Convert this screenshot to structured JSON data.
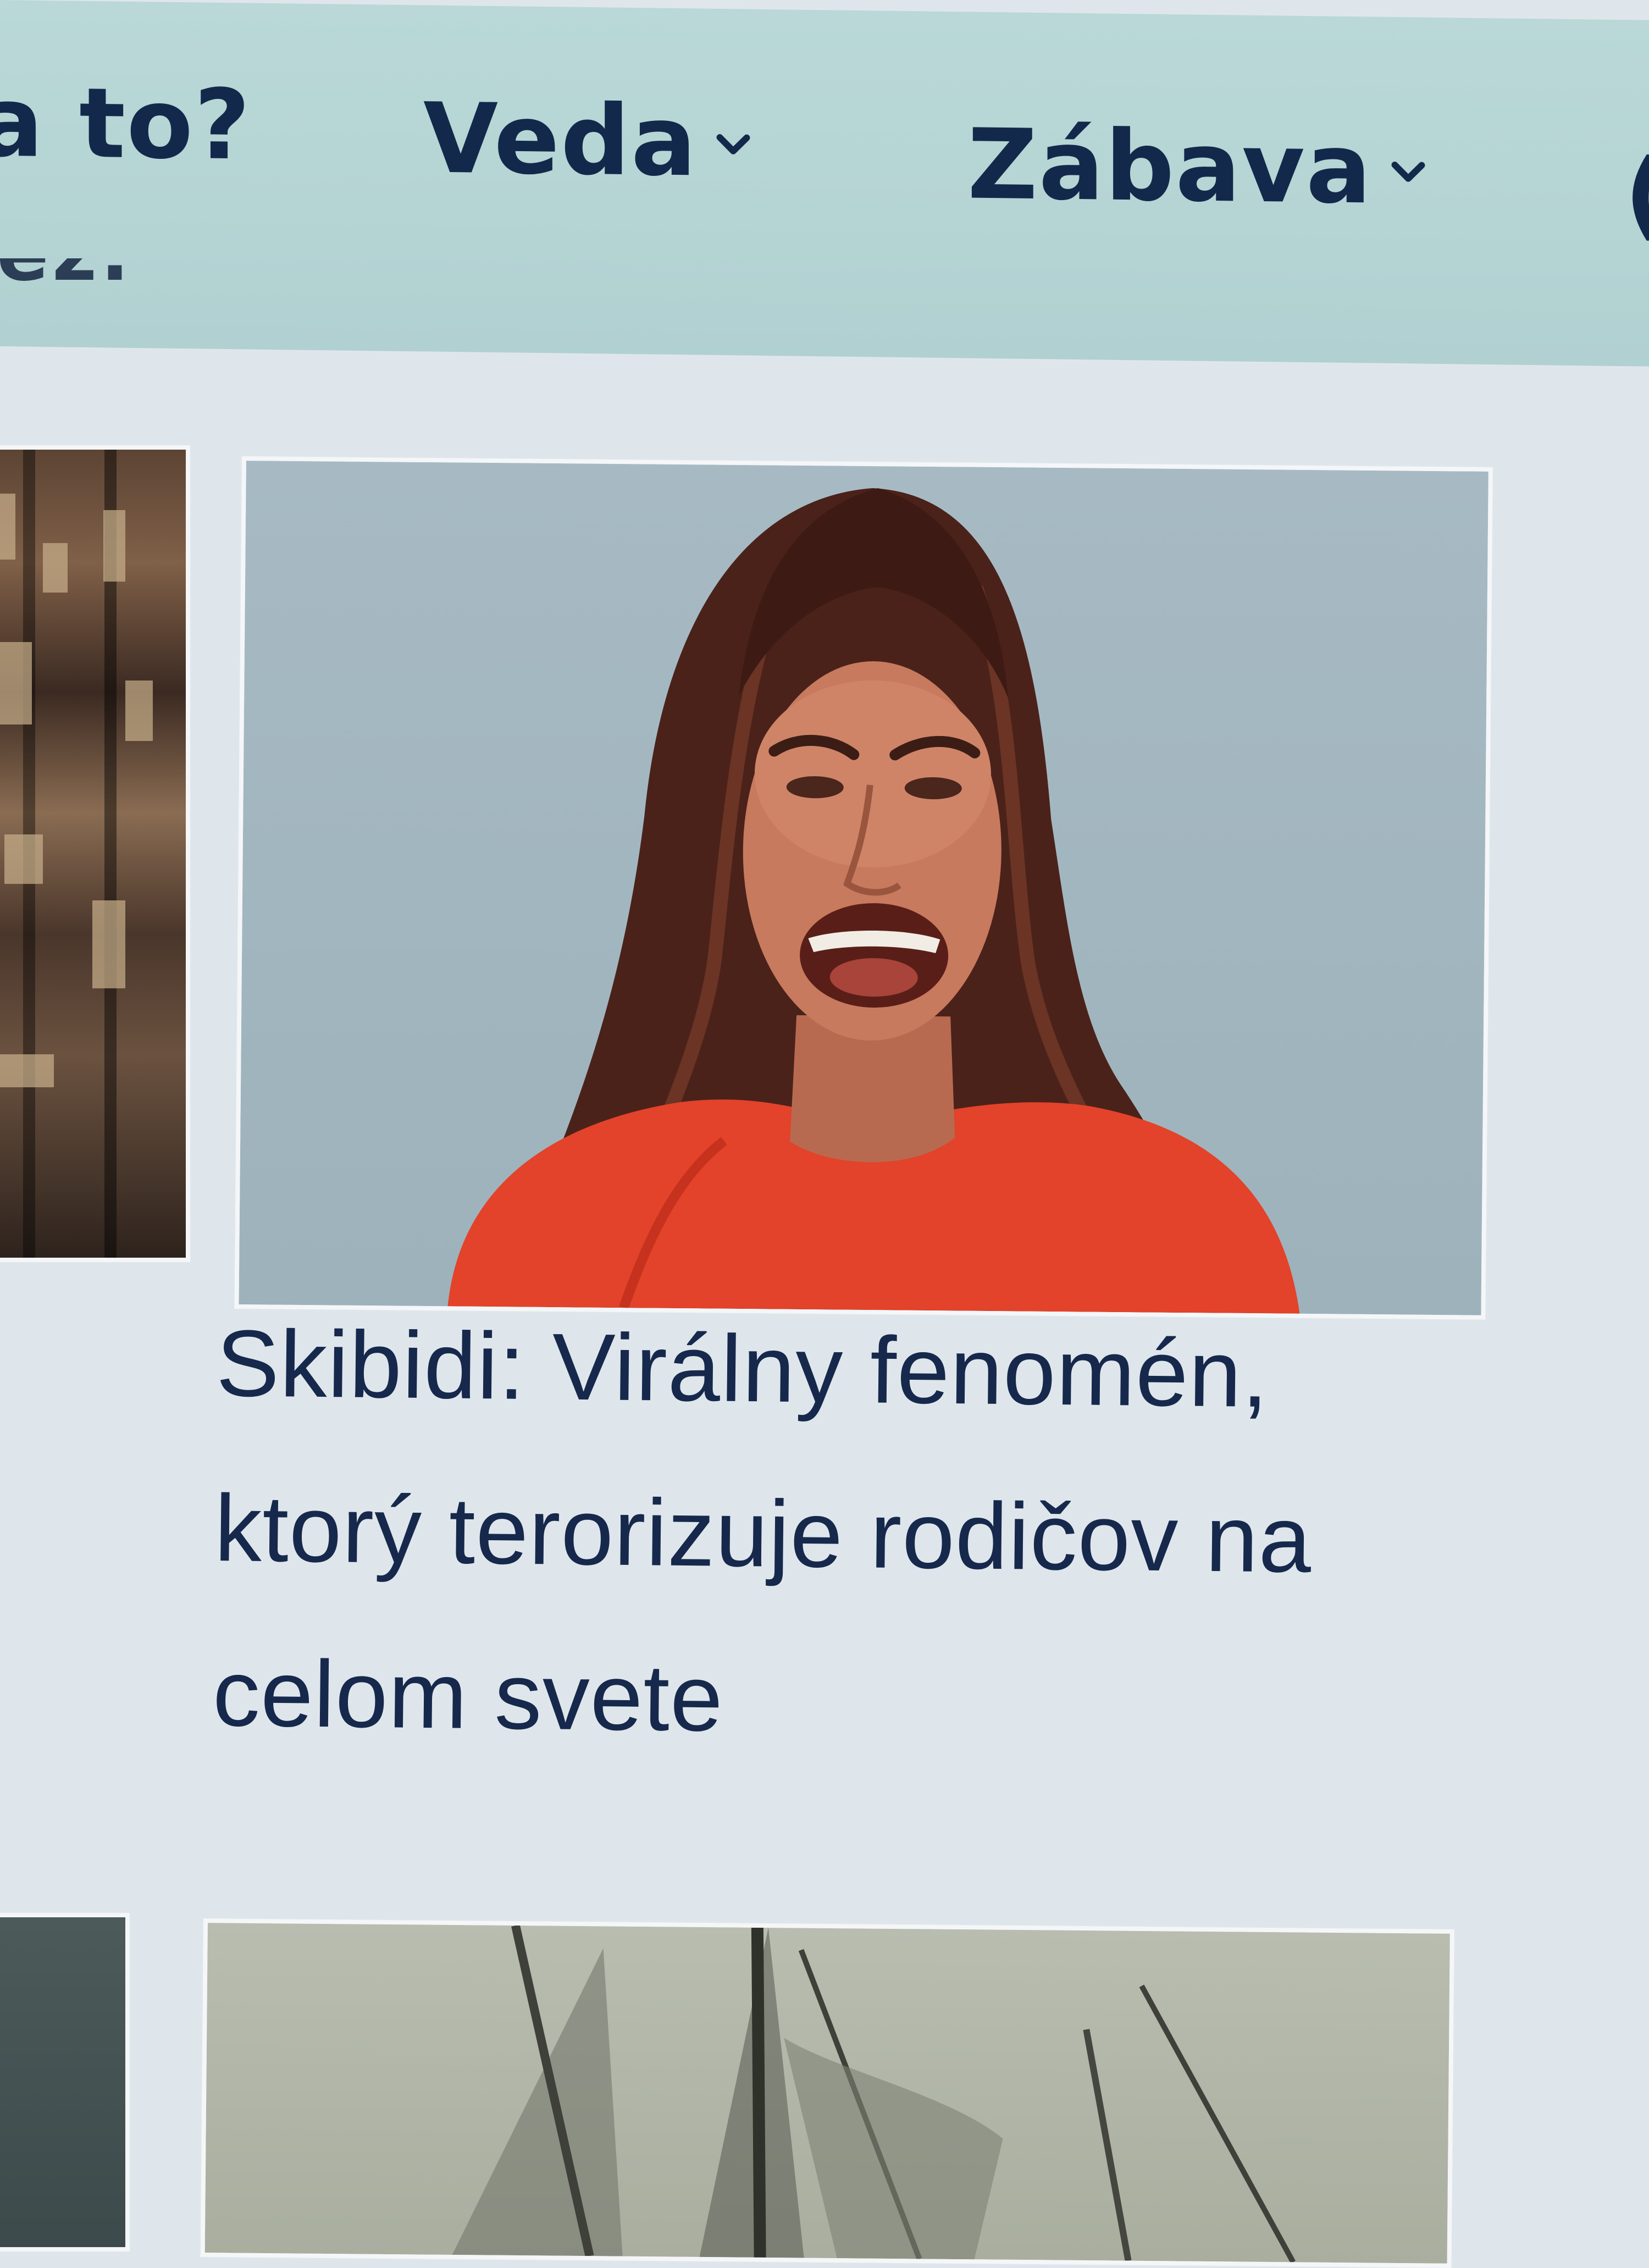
{
  "nav": {
    "items": [
      {
        "label": "a to?",
        "has_dropdown": false
      },
      {
        "label": "Veda",
        "has_dropdown": true
      },
      {
        "label": "Zábava",
        "has_dropdown": true
      },
      {
        "label": "(",
        "has_dropdown": false
      }
    ],
    "dropdown_icon": "chevron-down-icon"
  },
  "header_fragment": "iez.",
  "articles": [
    {
      "image_alt": "",
      "title": "Skibidi: Virálny fenomén, ktorý terorizuje rodičov na celom svete",
      "title_lines": [
        "Skibidi: Virálny fenomén,",
        "ktorý terorizuje rodičov na",
        "celom svete"
      ]
    }
  ],
  "colors": {
    "nav_background": "#b5d4d4",
    "page_background": "#dfe6eb",
    "text": "#152a4a",
    "accent_shirt": "#e2432a"
  }
}
